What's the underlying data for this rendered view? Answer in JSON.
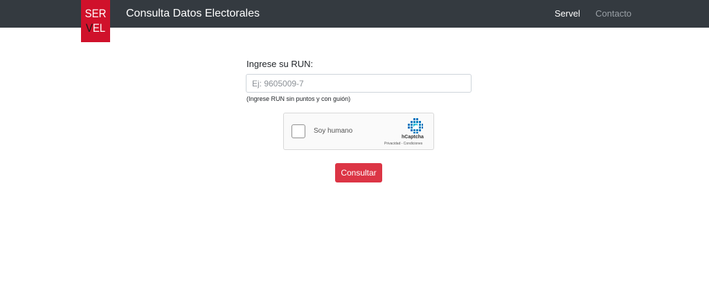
{
  "header": {
    "logo_line1": "SER",
    "logo_line2_v": "V",
    "logo_line2_rest": "EL",
    "brand": "Consulta Datos Electorales",
    "nav": {
      "servel": "Servel",
      "contacto": "Contacto"
    },
    "colors": {
      "bar": "#343a40",
      "logo": "#d0112b"
    }
  },
  "form": {
    "run_label": "Ingrese su RUN:",
    "run_placeholder": "Ej: 9605009-7",
    "run_value": "",
    "run_help": "(Ingrese RUN sin puntos y con guión)",
    "submit_label": "Consultar",
    "submit_color": "#dc3545"
  },
  "captcha": {
    "label": "Soy humano",
    "brand": "hCaptcha",
    "links": "Privacidad - Condiciones",
    "logo_icon": "hcaptcha-logo-icon"
  }
}
